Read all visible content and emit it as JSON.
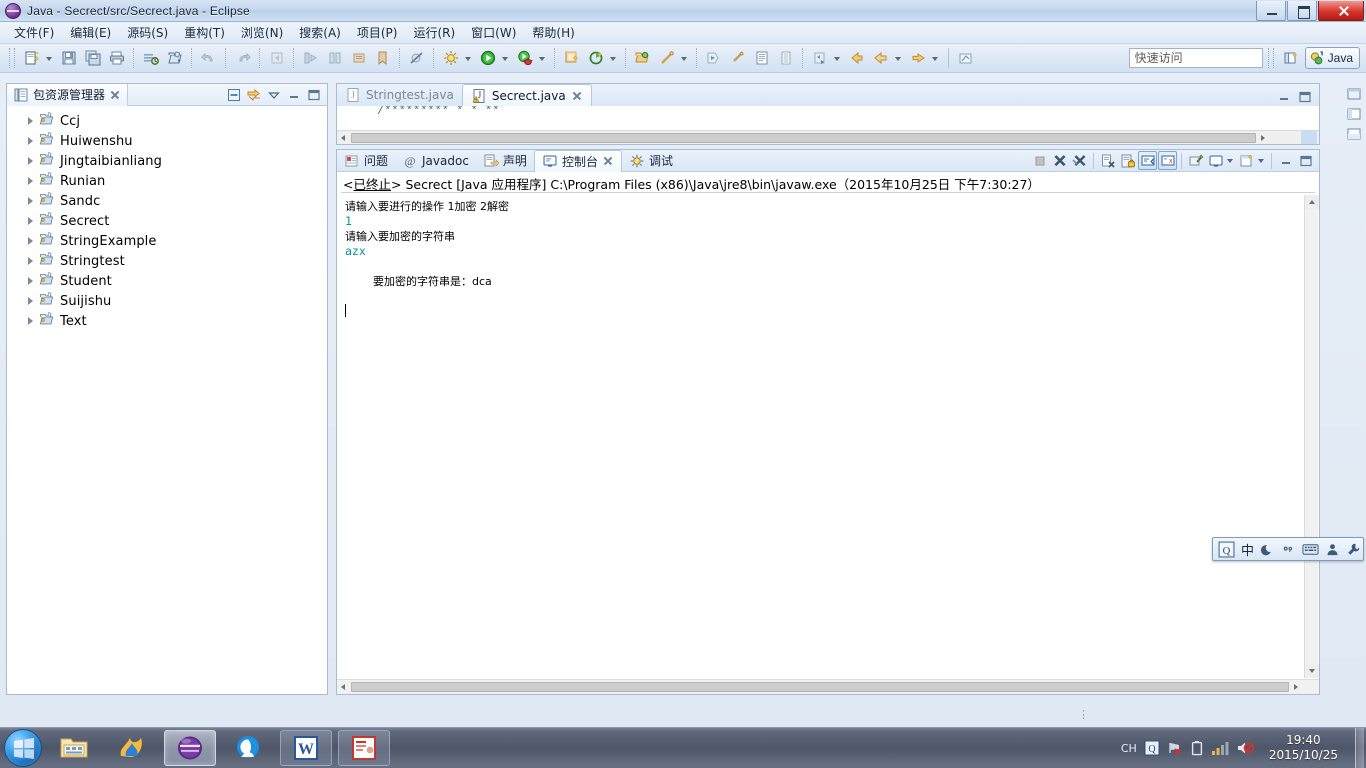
{
  "window": {
    "title": "Java - Secrect/src/Secrect.java - Eclipse",
    "app_icon": "eclipse-icon",
    "minimize_label": "minimize-icon",
    "maximize_label": "maximize-icon",
    "close_label": "close-icon"
  },
  "menubar": {
    "items": [
      {
        "label": "文件(F)"
      },
      {
        "label": "编辑(E)"
      },
      {
        "label": "源码(S)"
      },
      {
        "label": "重构(T)"
      },
      {
        "label": "浏览(N)"
      },
      {
        "label": "搜索(A)"
      },
      {
        "label": "项目(P)"
      },
      {
        "label": "运行(R)"
      },
      {
        "label": "窗口(W)"
      },
      {
        "label": "帮助(H)"
      }
    ]
  },
  "toolbar": {
    "quick_access_placeholder": "快速访问",
    "perspective_label": "Java",
    "open_perspective_icon": "open-perspective-icon",
    "buttons": [
      "new-wizard-icon",
      "save-icon",
      "save-all-icon",
      "print-icon",
      "build-all-icon",
      "new-java-project-icon",
      "undo-icon",
      "redo-icon",
      "back-icon",
      "next-annotation-icon",
      "previous-annotation-icon",
      "last-edit-icon",
      "bookmark-icon",
      "skip-breakpoints-icon",
      "external-tools-icon",
      "debug-icon",
      "run-icon",
      "coverage-icon",
      "new-java-class-icon",
      "new-java-package-icon",
      "open-type-icon",
      "search-icon",
      "toggle-breadcrumb-icon",
      "link-editor-icon",
      "open-task-icon",
      "pin-editor-icon",
      "previous-edit-icon",
      "back-history-icon",
      "forward-history-icon",
      "export-icon"
    ]
  },
  "package_explorer": {
    "tab_label": "包资源管理器",
    "tab_icon": "package-explorer-icon",
    "tools": [
      "collapse-all-icon",
      "link-with-editor-icon",
      "view-menu-icon",
      "minimize-icon",
      "maximize-icon"
    ],
    "items": [
      {
        "label": "Ccj",
        "icon": "java-project-icon"
      },
      {
        "label": "Huiwenshu",
        "icon": "java-project-icon"
      },
      {
        "label": "Jingtaibianliang",
        "icon": "java-project-icon"
      },
      {
        "label": "Runian",
        "icon": "java-project-icon"
      },
      {
        "label": "Sandc",
        "icon": "java-project-icon"
      },
      {
        "label": "Secrect",
        "icon": "java-project-icon"
      },
      {
        "label": "StringExample",
        "icon": "java-project-icon"
      },
      {
        "label": "Stringtest",
        "icon": "java-project-icon"
      },
      {
        "label": "Student",
        "icon": "java-project-icon"
      },
      {
        "label": "Suijishu",
        "icon": "java-project-icon"
      },
      {
        "label": "Text",
        "icon": "java-project-icon"
      }
    ]
  },
  "editor": {
    "tabs": [
      {
        "label": "Stringtest.java",
        "active": false,
        "icon": "java-file-icon"
      },
      {
        "label": "Secrect.java",
        "active": true,
        "icon": "java-file-warning-icon"
      }
    ],
    "code_fragment": "/*********  *   *   **",
    "minimize_icon": "minimize-icon",
    "maximize_icon": "maximize-icon"
  },
  "console": {
    "tabs": [
      {
        "label": "问题",
        "icon": "problems-icon",
        "active": false
      },
      {
        "label": "Javadoc",
        "icon": "javadoc-icon",
        "active": false
      },
      {
        "label": "声明",
        "icon": "declaration-icon",
        "active": false
      },
      {
        "label": "控制台",
        "icon": "console-icon",
        "active": true
      },
      {
        "label": "调试",
        "icon": "debug-icon",
        "active": false
      }
    ],
    "tools": [
      "terminate-icon",
      "remove-launch-icon",
      "remove-all-launches-icon",
      "clear-console-icon",
      "lock-scroll-icon",
      "scroll-lock-icon",
      "show-console-on-output-icon",
      "pin-console-icon",
      "display-selected-console-icon",
      "open-console-icon",
      "minimize-icon",
      "maximize-icon"
    ],
    "header": "<已终止> Secrect [Java 应用程序] C:\\Program Files (x86)\\Java\\jre8\\bin\\javaw.exe（2015年10月25日 下午7:30:27）",
    "header_terminated": "已终止",
    "output": [
      {
        "text": "请输入要进行的操作 1加密 2解密",
        "kind": "out"
      },
      {
        "text": "1",
        "kind": "in"
      },
      {
        "text": "请输入要加密的字符串",
        "kind": "out"
      },
      {
        "text": "azx",
        "kind": "in"
      },
      {
        "text": "要加密的字符串是：dca",
        "kind": "out"
      }
    ]
  },
  "ime_bar": {
    "items": [
      {
        "name": "ime-logo-icon",
        "label": "Q"
      },
      {
        "name": "ime-chinese-mode",
        "label": "中"
      },
      {
        "name": "ime-moon-icon",
        "label": ""
      },
      {
        "name": "ime-punctuation-icon",
        "label": "°,"
      },
      {
        "name": "ime-soft-keyboard-icon",
        "label": ""
      },
      {
        "name": "ime-user-icon",
        "label": ""
      },
      {
        "name": "ime-settings-icon",
        "label": ""
      }
    ]
  },
  "taskbar": {
    "start_label": "start-orb",
    "apps": [
      {
        "name": "file-explorer-icon",
        "state": "normal"
      },
      {
        "name": "browser-flame-icon",
        "state": "normal"
      },
      {
        "name": "eclipse-icon",
        "state": "active"
      },
      {
        "name": "browser-orb-icon",
        "state": "normal"
      },
      {
        "name": "word-icon",
        "state": "framed"
      },
      {
        "name": "powerpoint-icon",
        "state": "framed"
      }
    ],
    "tray": {
      "language": "CH",
      "icons": [
        "ime-tray-icon",
        "network-error-icon",
        "battery-icon",
        "signal-icon",
        "volume-muted-icon"
      ],
      "time": "19:40",
      "date": "2015/10/25"
    }
  }
}
